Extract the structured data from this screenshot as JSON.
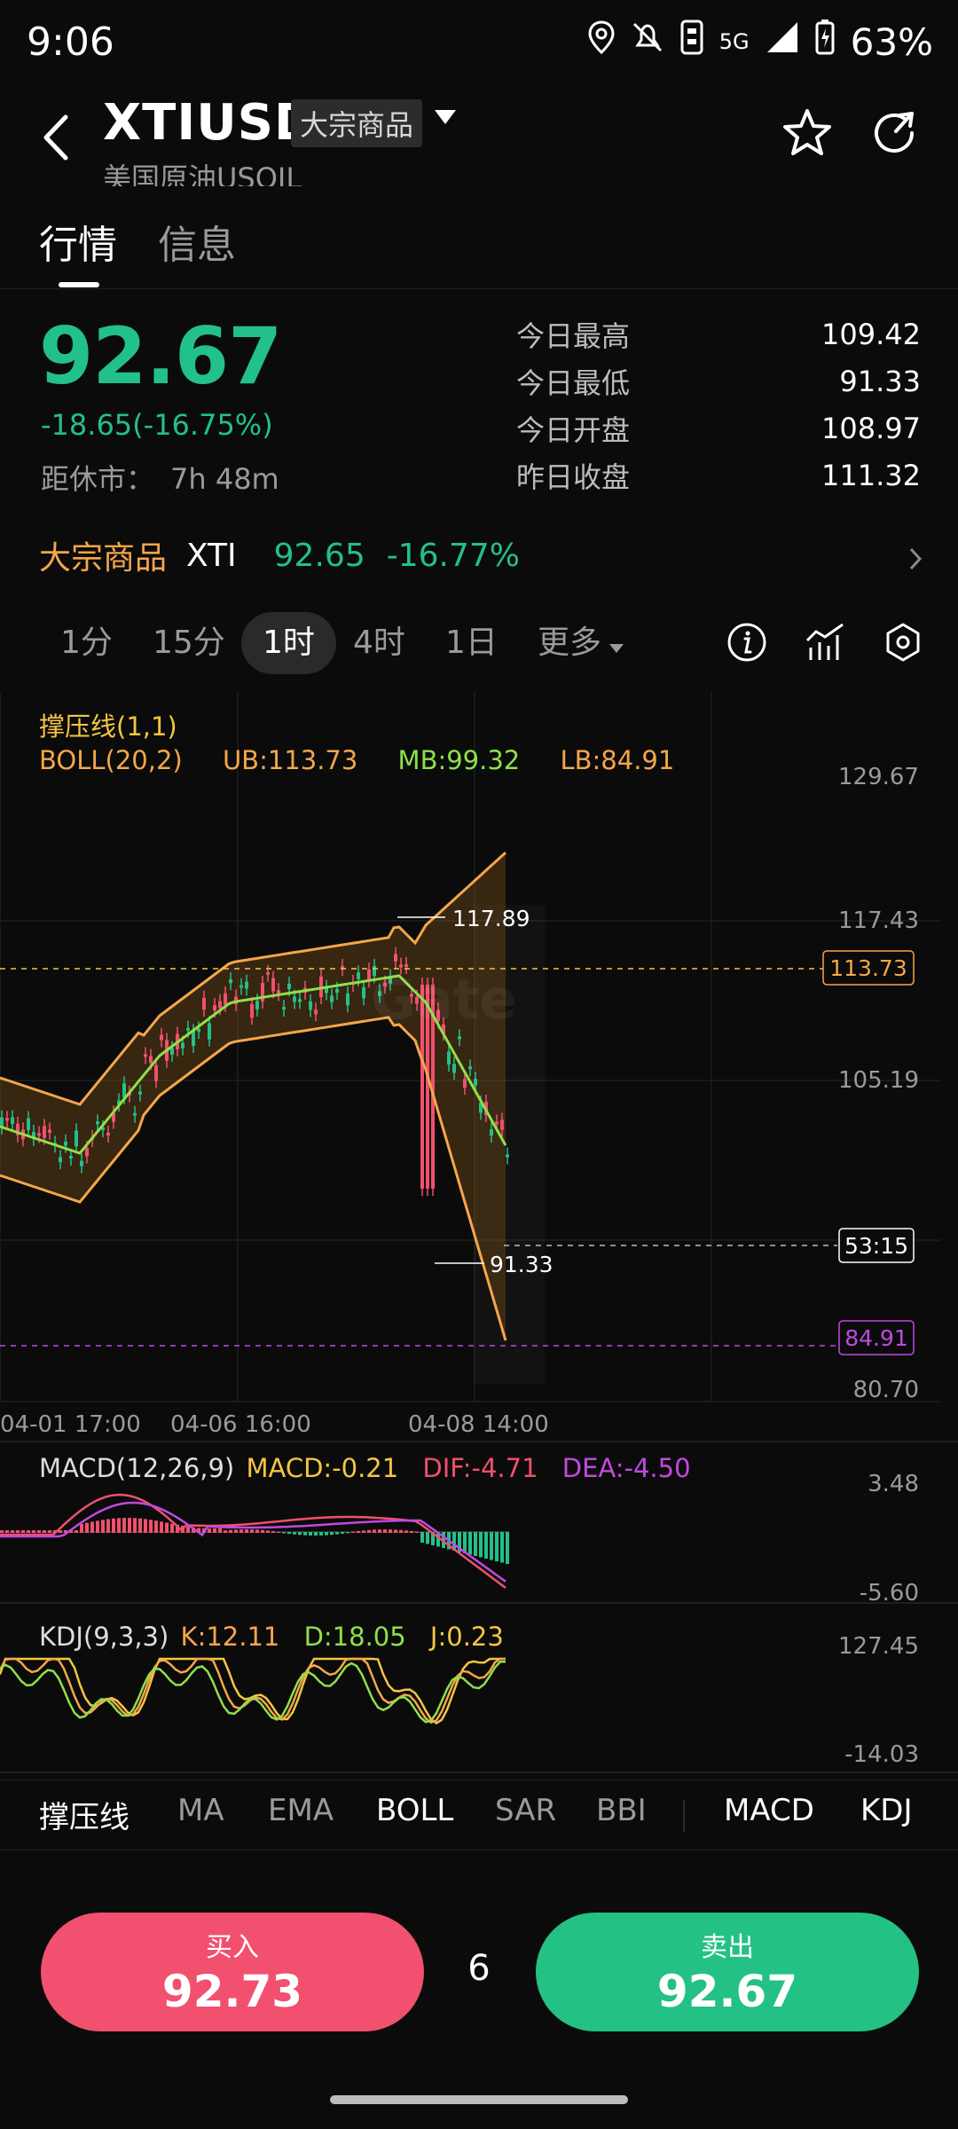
{
  "status_bar": {
    "time": "9:06",
    "network": "5G",
    "battery": "63%",
    "icons": [
      "location-icon",
      "mute-icon",
      "data-icon",
      "signal-icon",
      "battery-icon"
    ]
  },
  "header": {
    "symbol": "XTIUSD",
    "category": "大宗商品",
    "subtitle": "美国原油USOIL"
  },
  "tabs": [
    {
      "label": "行情",
      "active": true
    },
    {
      "label": "信息",
      "active": false
    }
  ],
  "quote": {
    "price": "92.67",
    "change": "-18.65(-16.75%)",
    "close_label": "距休市：",
    "close_value": "7h 48m",
    "stats": [
      {
        "label": "今日最高",
        "value": "109.42"
      },
      {
        "label": "今日最低",
        "value": "91.33"
      },
      {
        "label": "今日开盘",
        "value": "108.97"
      },
      {
        "label": "昨日收盘",
        "value": "111.32"
      }
    ]
  },
  "ticker": {
    "category": "大宗商品",
    "symbol": "XTI",
    "price": "92.65",
    "percent": "-16.77%"
  },
  "intervals": [
    {
      "label": "1分",
      "active": false
    },
    {
      "label": "15分",
      "active": false
    },
    {
      "label": "1时",
      "active": true
    },
    {
      "label": "4时",
      "active": false
    },
    {
      "label": "1日",
      "active": false
    },
    {
      "label": "更多",
      "active": false
    }
  ],
  "chart": {
    "indicator_title": "撑压线(1,1)",
    "boll": {
      "name": "BOLL(20,2)",
      "ub": "UB:113.73",
      "mb": "MB:99.32",
      "lb": "LB:84.91"
    },
    "y_ticks": [
      "129.67",
      "117.43",
      "105.19",
      "80.70"
    ],
    "x_ticks": [
      "04-01 17:00",
      "04-06 16:00",
      "04-08 14:00"
    ],
    "high_mark": "117.89",
    "low_mark": "91.33",
    "ub_tag": "113.73",
    "countdown_tag": "53:15",
    "lb_tag": "84.91",
    "watermark": "Gate",
    "colors": {
      "up": "#22c08a",
      "down": "#f1506e",
      "ub": "#f5a64a",
      "mb": "#8fe04a",
      "lb": "#f5a64a"
    }
  },
  "macd": {
    "name": "MACD(12,26,9)",
    "macd": "MACD:-0.21",
    "dif": "DIF:-4.71",
    "dea": "DEA:-4.50",
    "y_max": "3.48",
    "y_min": "-5.60"
  },
  "kdj": {
    "name": "KDJ(9,3,3)",
    "k": "K:12.11",
    "d": "D:18.05",
    "j": "J:0.23",
    "y_max": "127.45",
    "y_min": "-14.03"
  },
  "indicator_tabs": [
    {
      "label": "撑压线",
      "on": true
    },
    {
      "label": "MA",
      "on": false
    },
    {
      "label": "EMA",
      "on": false
    },
    {
      "label": "BOLL",
      "on": true
    },
    {
      "label": "SAR",
      "on": false
    },
    {
      "label": "BBI",
      "on": false
    },
    {
      "label": "MACD",
      "on": true
    },
    {
      "label": "KDJ",
      "on": true
    }
  ],
  "trade": {
    "buy_label": "买入",
    "buy_price": "92.73",
    "spread": "6",
    "sell_label": "卖出",
    "sell_price": "92.67"
  }
}
